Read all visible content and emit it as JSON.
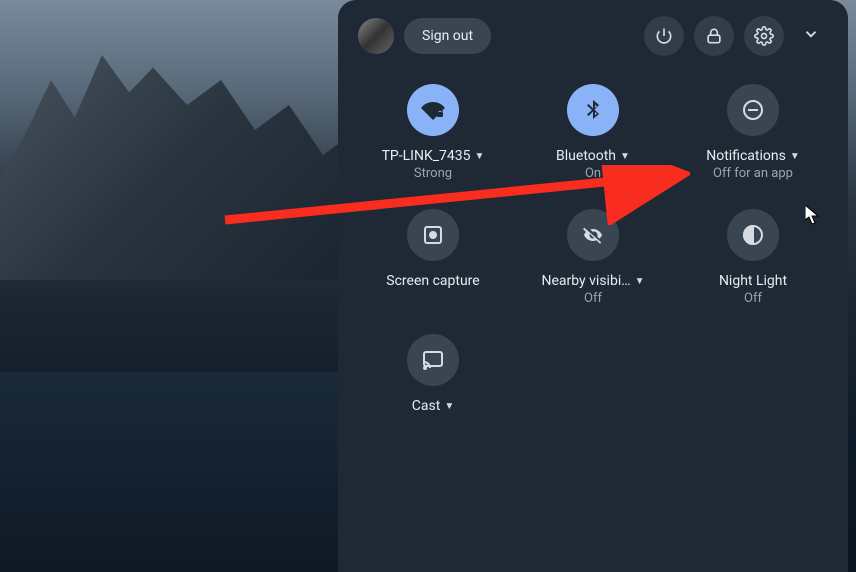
{
  "header": {
    "sign_out_label": "Sign out"
  },
  "tiles": {
    "wifi": {
      "label": "TP-LINK_7435",
      "sub": "Strong",
      "has_caret": true,
      "on": true
    },
    "bluetooth": {
      "label": "Bluetooth",
      "sub": "On",
      "has_caret": true,
      "on": true
    },
    "notifications": {
      "label": "Notifications",
      "sub": "Off for an app",
      "has_caret": true,
      "on": false
    },
    "screen_capture": {
      "label": "Screen capture",
      "sub": "",
      "has_caret": false,
      "on": false
    },
    "nearby": {
      "label": "Nearby visibi…",
      "sub": "Off",
      "has_caret": true,
      "on": false
    },
    "night_light": {
      "label": "Night Light",
      "sub": "Off",
      "has_caret": false,
      "on": false
    },
    "cast": {
      "label": "Cast",
      "sub": "",
      "has_caret": true,
      "on": false
    }
  },
  "colors": {
    "accent": "#8ab3f7",
    "panel": "#1e2935",
    "arrow": "#f82c1f"
  }
}
